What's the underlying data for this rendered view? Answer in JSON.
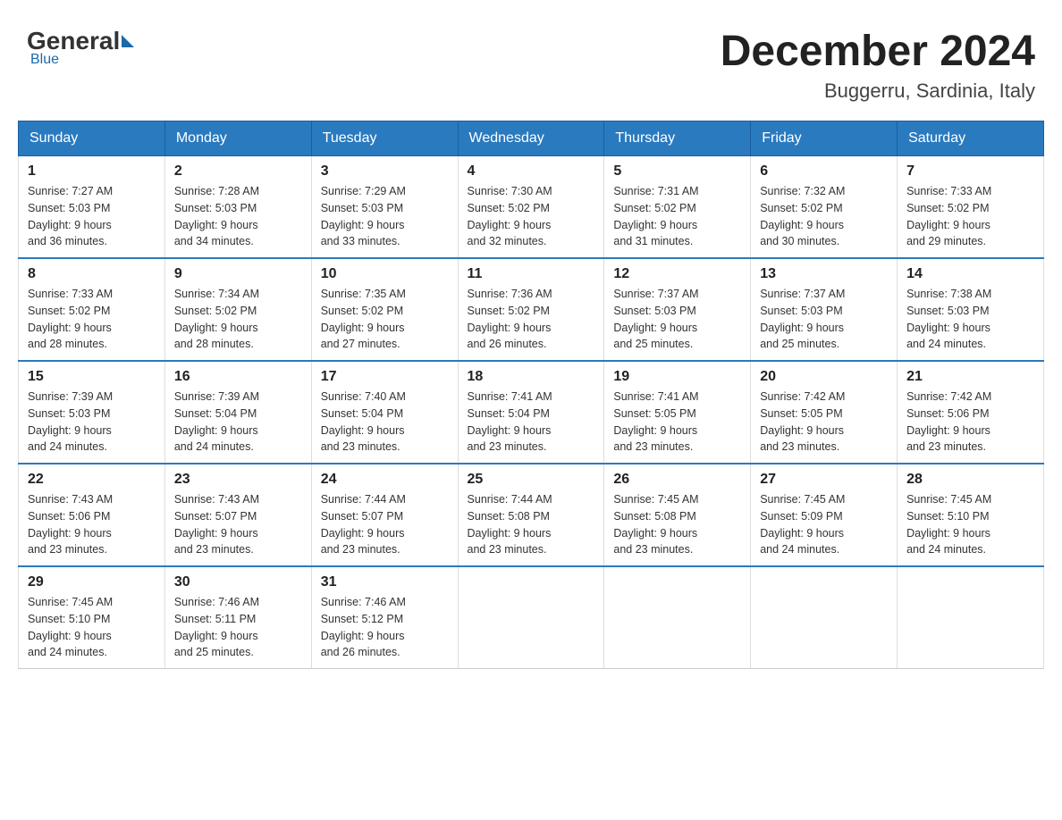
{
  "header": {
    "logo": {
      "general": "General",
      "blue": "Blue"
    },
    "title": "December 2024",
    "location": "Buggerru, Sardinia, Italy"
  },
  "days_of_week": [
    "Sunday",
    "Monday",
    "Tuesday",
    "Wednesday",
    "Thursday",
    "Friday",
    "Saturday"
  ],
  "weeks": [
    [
      {
        "day": "1",
        "sunrise": "7:27 AM",
        "sunset": "5:03 PM",
        "daylight": "9 hours and 36 minutes."
      },
      {
        "day": "2",
        "sunrise": "7:28 AM",
        "sunset": "5:03 PM",
        "daylight": "9 hours and 34 minutes."
      },
      {
        "day": "3",
        "sunrise": "7:29 AM",
        "sunset": "5:03 PM",
        "daylight": "9 hours and 33 minutes."
      },
      {
        "day": "4",
        "sunrise": "7:30 AM",
        "sunset": "5:02 PM",
        "daylight": "9 hours and 32 minutes."
      },
      {
        "day": "5",
        "sunrise": "7:31 AM",
        "sunset": "5:02 PM",
        "daylight": "9 hours and 31 minutes."
      },
      {
        "day": "6",
        "sunrise": "7:32 AM",
        "sunset": "5:02 PM",
        "daylight": "9 hours and 30 minutes."
      },
      {
        "day": "7",
        "sunrise": "7:33 AM",
        "sunset": "5:02 PM",
        "daylight": "9 hours and 29 minutes."
      }
    ],
    [
      {
        "day": "8",
        "sunrise": "7:33 AM",
        "sunset": "5:02 PM",
        "daylight": "9 hours and 28 minutes."
      },
      {
        "day": "9",
        "sunrise": "7:34 AM",
        "sunset": "5:02 PM",
        "daylight": "9 hours and 28 minutes."
      },
      {
        "day": "10",
        "sunrise": "7:35 AM",
        "sunset": "5:02 PM",
        "daylight": "9 hours and 27 minutes."
      },
      {
        "day": "11",
        "sunrise": "7:36 AM",
        "sunset": "5:02 PM",
        "daylight": "9 hours and 26 minutes."
      },
      {
        "day": "12",
        "sunrise": "7:37 AM",
        "sunset": "5:03 PM",
        "daylight": "9 hours and 25 minutes."
      },
      {
        "day": "13",
        "sunrise": "7:37 AM",
        "sunset": "5:03 PM",
        "daylight": "9 hours and 25 minutes."
      },
      {
        "day": "14",
        "sunrise": "7:38 AM",
        "sunset": "5:03 PM",
        "daylight": "9 hours and 24 minutes."
      }
    ],
    [
      {
        "day": "15",
        "sunrise": "7:39 AM",
        "sunset": "5:03 PM",
        "daylight": "9 hours and 24 minutes."
      },
      {
        "day": "16",
        "sunrise": "7:39 AM",
        "sunset": "5:04 PM",
        "daylight": "9 hours and 24 minutes."
      },
      {
        "day": "17",
        "sunrise": "7:40 AM",
        "sunset": "5:04 PM",
        "daylight": "9 hours and 23 minutes."
      },
      {
        "day": "18",
        "sunrise": "7:41 AM",
        "sunset": "5:04 PM",
        "daylight": "9 hours and 23 minutes."
      },
      {
        "day": "19",
        "sunrise": "7:41 AM",
        "sunset": "5:05 PM",
        "daylight": "9 hours and 23 minutes."
      },
      {
        "day": "20",
        "sunrise": "7:42 AM",
        "sunset": "5:05 PM",
        "daylight": "9 hours and 23 minutes."
      },
      {
        "day": "21",
        "sunrise": "7:42 AM",
        "sunset": "5:06 PM",
        "daylight": "9 hours and 23 minutes."
      }
    ],
    [
      {
        "day": "22",
        "sunrise": "7:43 AM",
        "sunset": "5:06 PM",
        "daylight": "9 hours and 23 minutes."
      },
      {
        "day": "23",
        "sunrise": "7:43 AM",
        "sunset": "5:07 PM",
        "daylight": "9 hours and 23 minutes."
      },
      {
        "day": "24",
        "sunrise": "7:44 AM",
        "sunset": "5:07 PM",
        "daylight": "9 hours and 23 minutes."
      },
      {
        "day": "25",
        "sunrise": "7:44 AM",
        "sunset": "5:08 PM",
        "daylight": "9 hours and 23 minutes."
      },
      {
        "day": "26",
        "sunrise": "7:45 AM",
        "sunset": "5:08 PM",
        "daylight": "9 hours and 23 minutes."
      },
      {
        "day": "27",
        "sunrise": "7:45 AM",
        "sunset": "5:09 PM",
        "daylight": "9 hours and 24 minutes."
      },
      {
        "day": "28",
        "sunrise": "7:45 AM",
        "sunset": "5:10 PM",
        "daylight": "9 hours and 24 minutes."
      }
    ],
    [
      {
        "day": "29",
        "sunrise": "7:45 AM",
        "sunset": "5:10 PM",
        "daylight": "9 hours and 24 minutes."
      },
      {
        "day": "30",
        "sunrise": "7:46 AM",
        "sunset": "5:11 PM",
        "daylight": "9 hours and 25 minutes."
      },
      {
        "day": "31",
        "sunrise": "7:46 AM",
        "sunset": "5:12 PM",
        "daylight": "9 hours and 26 minutes."
      },
      null,
      null,
      null,
      null
    ]
  ],
  "labels": {
    "sunrise": "Sunrise:",
    "sunset": "Sunset:",
    "daylight": "Daylight:"
  }
}
